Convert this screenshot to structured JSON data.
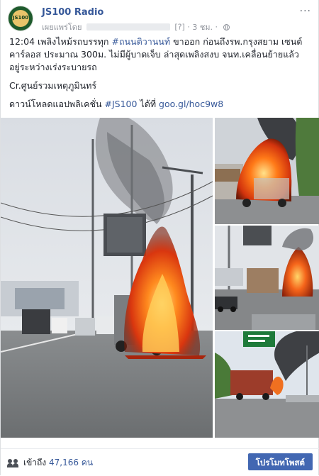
{
  "post": {
    "page_name": "JS100 Radio",
    "published_by_label": "เผยแพร่โดย",
    "privacy_marker": "[?]",
    "time": "3 ชม.",
    "time_separator": "·",
    "more_label": "···",
    "avatar_text": "JS100",
    "lines": [
      {
        "prefix": "12:04 เพลิงไหม้รถบรรทุก ",
        "hashtag": "#ถนนติวานนท์",
        "suffix": " ขาออก ก่อนถึงรพ.กรุงสยาม เซนต์คาร์ลอส ประมาณ 300ม. ไม่มีผู้บาดเจ็บ ล่าสุดเพลิงสงบ จนท.เคลื่อนย้ายแล้ว อยู่ระหว่างเร่งระบายรถ"
      },
      {
        "text": "Cr.ศูนย์รวมเหตุภูมินทร์"
      },
      {
        "prefix": "ดาวน์โหลดแอปพลิเคชั่น ",
        "hashtag": "#JS100",
        "middle": " ได้ที่ ",
        "url": "goo.gl/hoc9w8"
      }
    ]
  },
  "photos": [
    {
      "alt": "truck-fire-main"
    },
    {
      "alt": "truck-fire-closeup"
    },
    {
      "alt": "truck-fire-road"
    },
    {
      "alt": "truck-fire-smoke"
    }
  ],
  "footer": {
    "reach_label": "เข้าถึง",
    "reach_count": "47,166 คน",
    "promote_label": "โปรโมทโพสต์"
  },
  "colors": {
    "link": "#365899",
    "button": "#4267b2",
    "fire": "#e8501a",
    "smoke": "#3b3b3b"
  }
}
